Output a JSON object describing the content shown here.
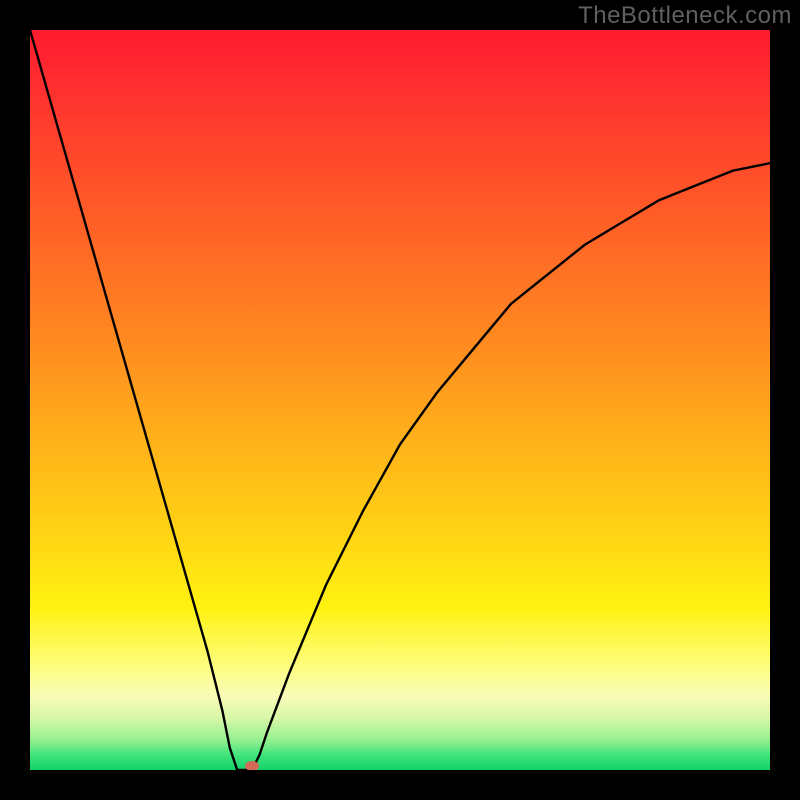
{
  "watermark": "TheBottleneck.com",
  "chart_data": {
    "type": "line",
    "title": "",
    "xlabel": "",
    "ylabel": "",
    "xlim": [
      0,
      100
    ],
    "ylim": [
      0,
      100
    ],
    "grid": false,
    "legend": false,
    "gradient_stops": [
      {
        "pos": 0,
        "color": "#ff1a2e"
      },
      {
        "pos": 8,
        "color": "#ff3030"
      },
      {
        "pos": 18,
        "color": "#ff4a2a"
      },
      {
        "pos": 30,
        "color": "#ff6a25"
      },
      {
        "pos": 42,
        "color": "#ff8a20"
      },
      {
        "pos": 55,
        "color": "#ffb01a"
      },
      {
        "pos": 68,
        "color": "#ffd314"
      },
      {
        "pos": 78,
        "color": "#fff210"
      },
      {
        "pos": 86,
        "color": "#fdfd7e"
      },
      {
        "pos": 90,
        "color": "#f9fcb8"
      },
      {
        "pos": 93,
        "color": "#d7f7a8"
      },
      {
        "pos": 96,
        "color": "#93f090"
      },
      {
        "pos": 98,
        "color": "#3fe37a"
      },
      {
        "pos": 100,
        "color": "#14d26a"
      }
    ],
    "series": [
      {
        "name": "bottleneck-curve",
        "x": [
          0,
          4,
          8,
          12,
          16,
          20,
          24,
          26,
          27,
          28,
          29,
          30,
          31,
          32,
          35,
          40,
          45,
          50,
          55,
          60,
          65,
          70,
          75,
          80,
          85,
          90,
          95,
          100
        ],
        "y": [
          100,
          86,
          72,
          58,
          44,
          30,
          16,
          8,
          3,
          0,
          0,
          0,
          2,
          5,
          13,
          25,
          35,
          44,
          51,
          57,
          63,
          67,
          71,
          74,
          77,
          79,
          81,
          82
        ]
      }
    ],
    "marker": {
      "x": 30,
      "y": 0,
      "color": "#d46a5a"
    }
  }
}
